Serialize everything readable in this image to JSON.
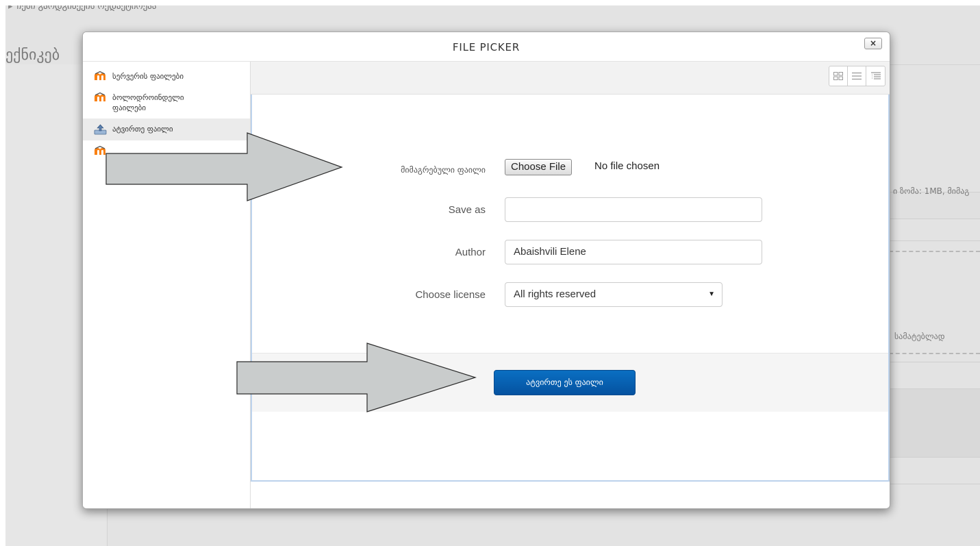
{
  "background_page": {
    "breadcrumb": "ჩემი გაოდგინეეის ოედაქტიოეაა",
    "heading": "ექნიკებ",
    "size_note": "ი ზომა: 1MB, მიმაგ",
    "side_text": "სამატებლად"
  },
  "dialog": {
    "title": "FILE PICKER",
    "close_label": "×",
    "repositories": [
      {
        "label": "სერვერის ფაილები",
        "icon": "moodle-icon"
      },
      {
        "label": "ბოლოდროინდელი ფაილები",
        "icon": "moodle-icon"
      },
      {
        "label": "ატვირთე ფაილი",
        "icon": "upload-icon",
        "active": true
      },
      {
        "label": "",
        "icon": "moodle-icon"
      }
    ],
    "view_buttons": [
      "icons-view",
      "list-view",
      "tree-view"
    ],
    "form": {
      "attachment_label": "მიმაგრებული ფაილი",
      "choose_file_label": "Choose File",
      "no_file_text": "No file chosen",
      "saveas_label": "Save as",
      "saveas_value": "",
      "author_label": "Author",
      "author_value": "Abaishvili Elene",
      "license_label": "Choose license",
      "license_value": "All rights reserved",
      "upload_button": "ატვირთე ეს ფაილი"
    }
  },
  "colors": {
    "primary_button": "#0a63b5",
    "overlay_bg": "#e3e3e3",
    "moodle_orange": "#f98012",
    "arrow_fill": "#c9cccc"
  }
}
